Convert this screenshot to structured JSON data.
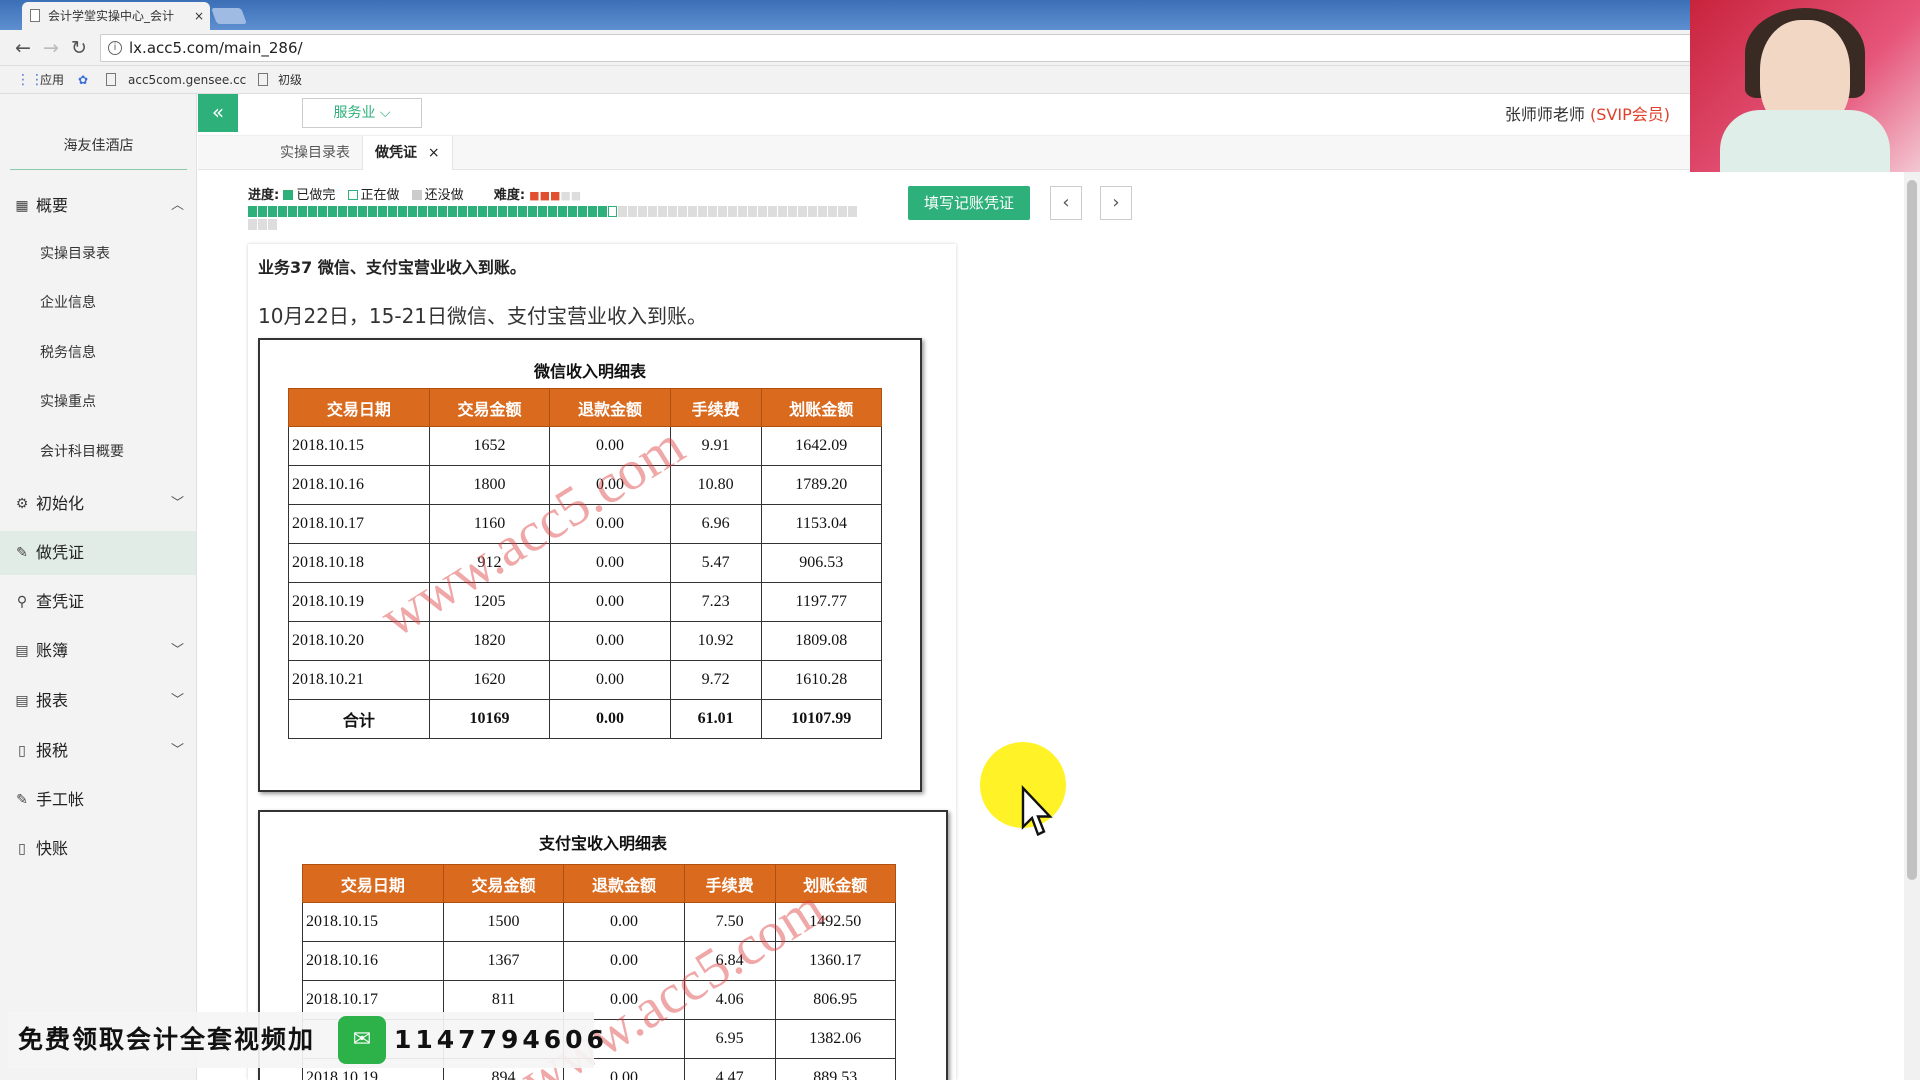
{
  "browser": {
    "tab_title": "会计学堂实操中心_会计",
    "tab_close": "×",
    "url": "lx.acc5.com/main_286/",
    "bookmarks": [
      "应用",
      "acc5com.gensee.cc",
      "初级"
    ],
    "nav_back": "←",
    "nav_forward": "→",
    "nav_reload": "↻"
  },
  "sidebar": {
    "company": "海友佳酒店",
    "items": [
      {
        "label": "概要",
        "icon": "overview-icon"
      },
      {
        "label": "初始化",
        "icon": "settings-icon"
      },
      {
        "label": "做凭证",
        "icon": "pencil-icon"
      },
      {
        "label": "查凭证",
        "icon": "search-icon"
      },
      {
        "label": "账簿",
        "icon": "ledger-icon"
      },
      {
        "label": "报表",
        "icon": "report-icon"
      },
      {
        "label": "报税",
        "icon": "document-icon"
      },
      {
        "label": "手工帐",
        "icon": "pencil-icon"
      },
      {
        "label": "快账",
        "icon": "document-icon"
      }
    ],
    "subitems": [
      "实操目录表",
      "企业信息",
      "税务信息",
      "实操重点",
      "会计科目概要"
    ]
  },
  "topbar": {
    "collapse": "«",
    "industry": "服务业 ⌵",
    "teacher": "张师师老师",
    "member": "(SVIP会员)"
  },
  "tabs": [
    "实操目录表",
    "做凭证"
  ],
  "tab_close": "×",
  "progress": {
    "label": "进度:",
    "done": "已做完",
    "doing": "正在做",
    "todo": "还没做",
    "difficulty_label": "难度:",
    "difficulty": 3,
    "difficulty_max": 5,
    "completed": 36,
    "total": 64
  },
  "actions": {
    "fill": "填写记账凭证",
    "prev": "‹",
    "next": "›"
  },
  "business": {
    "title": "业务37 微信、支付宝营业收入到账。",
    "desc": "10月22日，15-21日微信、支付宝营业收入到账。"
  },
  "wechat_table": {
    "title": "微信收入明细表",
    "headers": [
      "交易日期",
      "交易金额",
      "退款金额",
      "手续费",
      "划账金额"
    ],
    "rows": [
      [
        "2018.10.15",
        "1652",
        "0.00",
        "9.91",
        "1642.09"
      ],
      [
        "2018.10.16",
        "1800",
        "0.00",
        "10.80",
        "1789.20"
      ],
      [
        "2018.10.17",
        "1160",
        "0.00",
        "6.96",
        "1153.04"
      ],
      [
        "2018.10.18",
        "912",
        "0.00",
        "5.47",
        "906.53"
      ],
      [
        "2018.10.19",
        "1205",
        "0.00",
        "7.23",
        "1197.77"
      ],
      [
        "2018.10.20",
        "1820",
        "0.00",
        "10.92",
        "1809.08"
      ],
      [
        "2018.10.21",
        "1620",
        "0.00",
        "9.72",
        "1610.28"
      ]
    ],
    "total": [
      "合计",
      "10169",
      "0.00",
      "61.01",
      "10107.99"
    ]
  },
  "alipay_table": {
    "title": "支付宝收入明细表",
    "headers": [
      "交易日期",
      "交易金额",
      "退款金额",
      "手续费",
      "划账金额"
    ],
    "rows": [
      [
        "2018.10.15",
        "1500",
        "0.00",
        "7.50",
        "1492.50"
      ],
      [
        "2018.10.16",
        "1367",
        "0.00",
        "6.84",
        "1360.17"
      ],
      [
        "2018.10.17",
        "811",
        "0.00",
        "4.06",
        "806.95"
      ],
      [
        "",
        "",
        "",
        "6.95",
        "1382.06"
      ],
      [
        "2018.10.19",
        "894",
        "0.00",
        "4.47",
        "889.53"
      ]
    ]
  },
  "watermark": "www.acc5.com",
  "promo": {
    "text": "免费领取会计全套视频加",
    "number": "1147794606"
  }
}
